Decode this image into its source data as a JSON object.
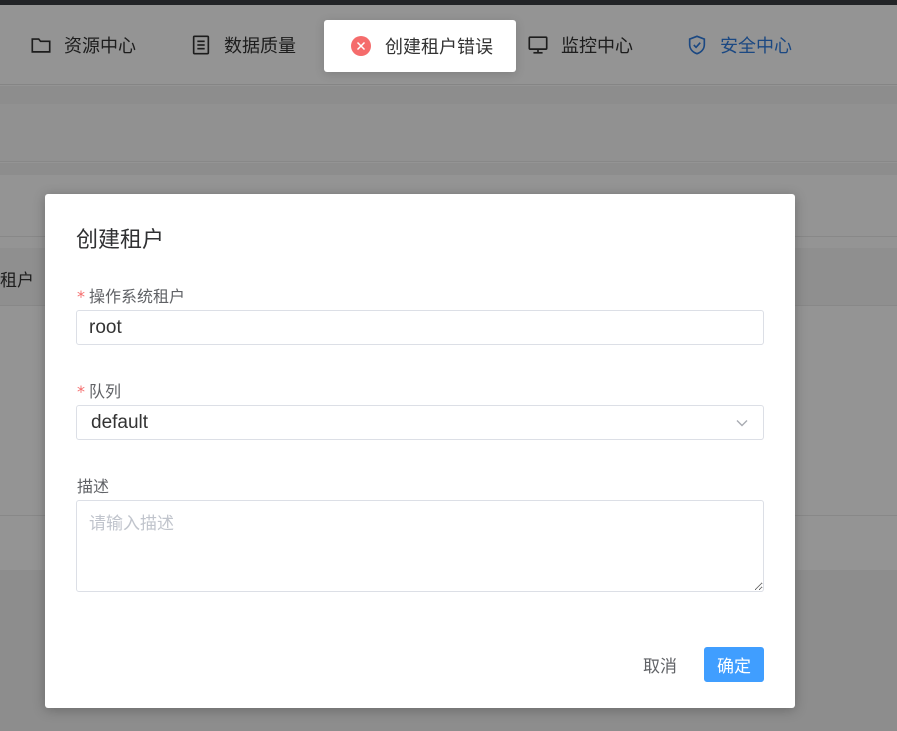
{
  "nav": {
    "items": [
      {
        "label": "资源中心",
        "icon": "folder-icon"
      },
      {
        "label": "数据质量",
        "icon": "document-icon"
      },
      {
        "label": "监控中心",
        "icon": "monitor-icon"
      },
      {
        "label": "安全中心",
        "icon": "shield-icon",
        "active": true
      }
    ]
  },
  "background": {
    "table_header_fragment": "租户"
  },
  "dialog": {
    "title": "创建租户",
    "fields": {
      "tenant": {
        "label": "操作系统租户",
        "value": "root",
        "required": true
      },
      "queue": {
        "label": "队列",
        "value": "default",
        "required": true
      },
      "description": {
        "label": "描述",
        "placeholder": "请输入描述",
        "value": ""
      }
    },
    "cancel_label": "取消",
    "confirm_label": "确定"
  },
  "toast": {
    "message": "创建租户错误",
    "type": "error"
  },
  "colors": {
    "primary": "#409eff",
    "active_nav": "#2f7de1",
    "error": "#f56c6c",
    "required_mark": "#f56c6c"
  }
}
